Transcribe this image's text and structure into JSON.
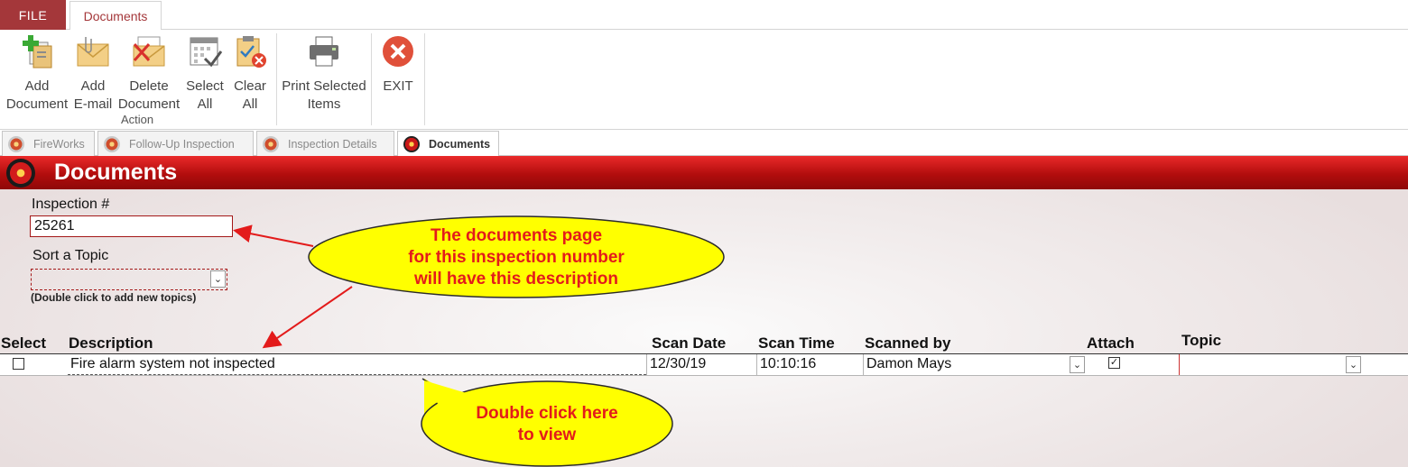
{
  "ribbon": {
    "tabs": {
      "file": "FILE",
      "documents": "Documents"
    },
    "buttons": {
      "add_document": [
        "Add",
        "Document"
      ],
      "add_email": [
        "Add",
        "E-mail"
      ],
      "delete_document": [
        "Delete",
        "Document"
      ],
      "select_all": [
        "Select",
        "All"
      ],
      "clear_all": [
        "Clear",
        "All"
      ],
      "print_selected": [
        "Print Selected",
        "Items"
      ],
      "exit": "EXIT"
    },
    "group_label": "Action"
  },
  "doc_tabs": [
    "FireWorks",
    "Follow-Up Inspection",
    "Inspection Details",
    "Documents"
  ],
  "header": {
    "title": "Documents"
  },
  "form": {
    "inspection_label": "Inspection #",
    "inspection_value": "25261",
    "topic_label": "Sort a Topic",
    "topic_value": "",
    "topic_hint": "(Double click to add new topics)"
  },
  "table": {
    "columns": [
      "Select",
      "Description",
      "Scan Date",
      "Scan Time",
      "Scanned by",
      "Attach",
      "Topic"
    ],
    "rows": [
      {
        "select": false,
        "description": "Fire alarm system not inspected",
        "scan_date": "12/30/19",
        "scan_time": "10:10:16",
        "scanned_by": "Damon Mays",
        "attach": true,
        "topic": ""
      }
    ]
  },
  "callouts": {
    "top": [
      "The documents page",
      "for this inspection number",
      "will have this description"
    ],
    "bottom": [
      "Double click here",
      "to view"
    ]
  },
  "colors": {
    "accent": "#a4373a",
    "header_red": "#c01212",
    "callout_fill": "#ffff00",
    "callout_text": "#e31b1b"
  }
}
